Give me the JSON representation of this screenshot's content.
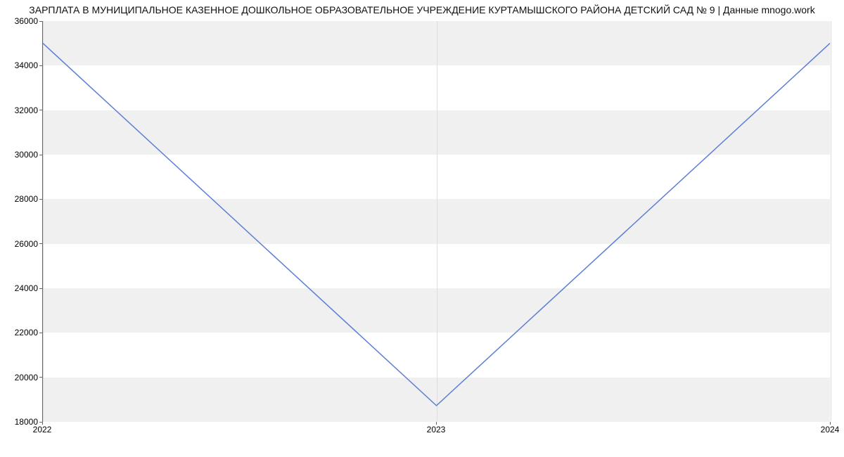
{
  "chart_data": {
    "type": "line",
    "title": "ЗАРПЛАТА В МУНИЦИПАЛЬНОЕ КАЗЕННОЕ ДОШКОЛЬНОЕ ОБРАЗОВАТЕЛЬНОЕ УЧРЕЖДЕНИЕ КУРТАМЫШСКОГО РАЙОНА ДЕТСКИЙ САД № 9 | Данные mnogo.work",
    "xlabel": "",
    "ylabel": "",
    "x": [
      "2022",
      "2023",
      "2024"
    ],
    "values": [
      35000,
      18700,
      35000
    ],
    "y_ticks": [
      18000,
      20000,
      22000,
      24000,
      26000,
      28000,
      30000,
      32000,
      34000,
      36000
    ],
    "ylim": [
      18000,
      36000
    ],
    "line_color": "#5b7fd6",
    "grid": true
  }
}
